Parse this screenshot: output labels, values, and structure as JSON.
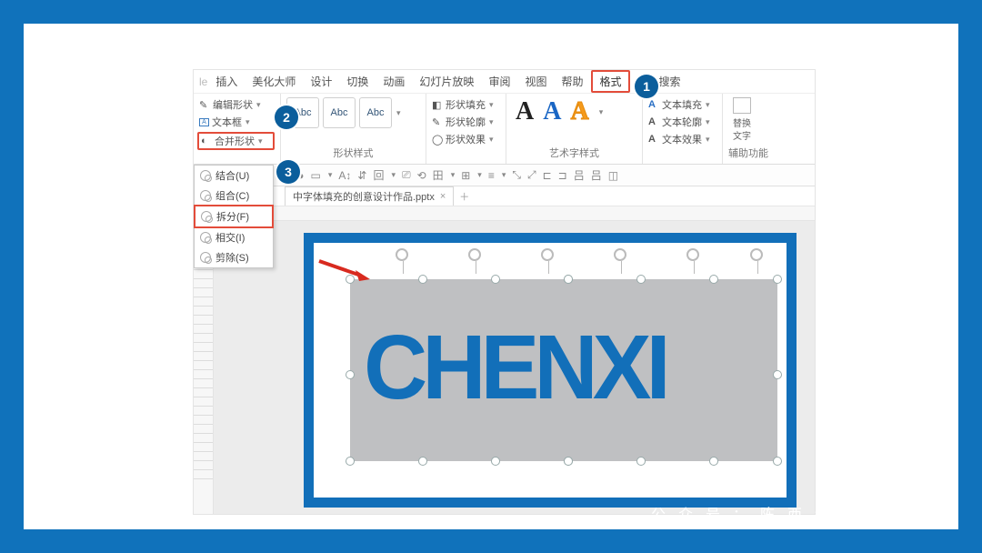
{
  "menu": {
    "insert": "插入",
    "beautify": "美化大师",
    "design": "设计",
    "transition": "切换",
    "anim": "动画",
    "slideshow": "幻灯片放映",
    "review": "审阅",
    "view": "视图",
    "help": "帮助",
    "format": "格式",
    "search": "搜索"
  },
  "ribbon": {
    "editshape": "编辑形状",
    "textbox": "文本框",
    "merge": "合并形状",
    "styles_cap": "形状样式",
    "shapefill": "形状填充",
    "shapeoutline": "形状轮廓",
    "shapefx": "形状效果",
    "wordart_cap": "艺术字样式",
    "textfill": "文本填充",
    "textoutline": "文本轮廓",
    "textfx": "文本效果",
    "alt_l1": "替换",
    "alt_l2": "文字",
    "alt_cap": "辅助功能",
    "abc": "Abc"
  },
  "dd": {
    "union": "结合(U)",
    "combine": "组合(C)",
    "split": "拆分(F)",
    "intersect": "相交(I)",
    "subtract": "剪除(S)"
  },
  "doc": {
    "name": "中字体填充的创意设计作品.pptx"
  },
  "canvas": {
    "text": "CHENXI"
  },
  "badges": {
    "b1": "1",
    "b2": "2",
    "b3": "3"
  },
  "footer": "公众号：陈西设计之家"
}
